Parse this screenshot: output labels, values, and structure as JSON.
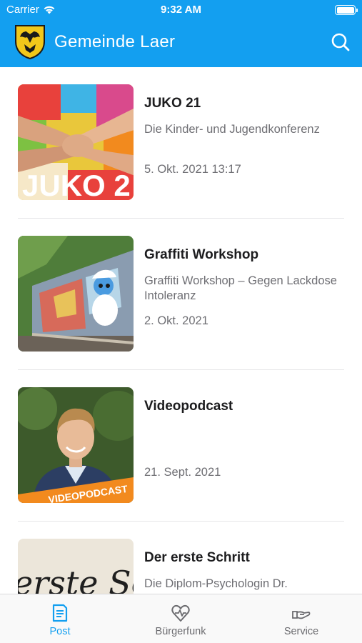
{
  "status_bar": {
    "carrier": "Carrier",
    "time": "9:32 AM",
    "battery_level": 1.0
  },
  "navbar": {
    "title": "Gemeinde Laer",
    "search_icon": "search-icon",
    "logo_icon": "municipal-crest-icon"
  },
  "posts": [
    {
      "title": "JUKO 21",
      "subtitle": "Die Kinder- und Jugendkonferenz",
      "date": "5. Okt. 2021 13:17",
      "image_text": "JUKO 2"
    },
    {
      "title": "Graffiti Workshop",
      "subtitle": "Graffiti Workshop – Gegen Lackdose Intoleranz",
      "date": "2. Okt. 2021"
    },
    {
      "title": "Videopodcast",
      "subtitle": "",
      "date": "21. Sept. 2021",
      "image_text": "VIDEOPODCAST"
    },
    {
      "title": "Der erste Schritt",
      "subtitle": "Die Diplom-Psychologin Dr.",
      "date": "",
      "image_text": "erste Sc"
    }
  ],
  "tabbar": {
    "active": "Post",
    "tabs": [
      {
        "label": "Post",
        "icon": "document-icon"
      },
      {
        "label": "Bürgerfunk",
        "icon": "heart-broadcast-icon"
      },
      {
        "label": "Service",
        "icon": "hand-service-icon"
      }
    ]
  },
  "colors": {
    "accent": "#139ff0",
    "text": "#1c1c1e",
    "secondary": "#6e6e73",
    "tab_inactive": "#6b6b6f",
    "badge_orange": "#f28a1e"
  }
}
